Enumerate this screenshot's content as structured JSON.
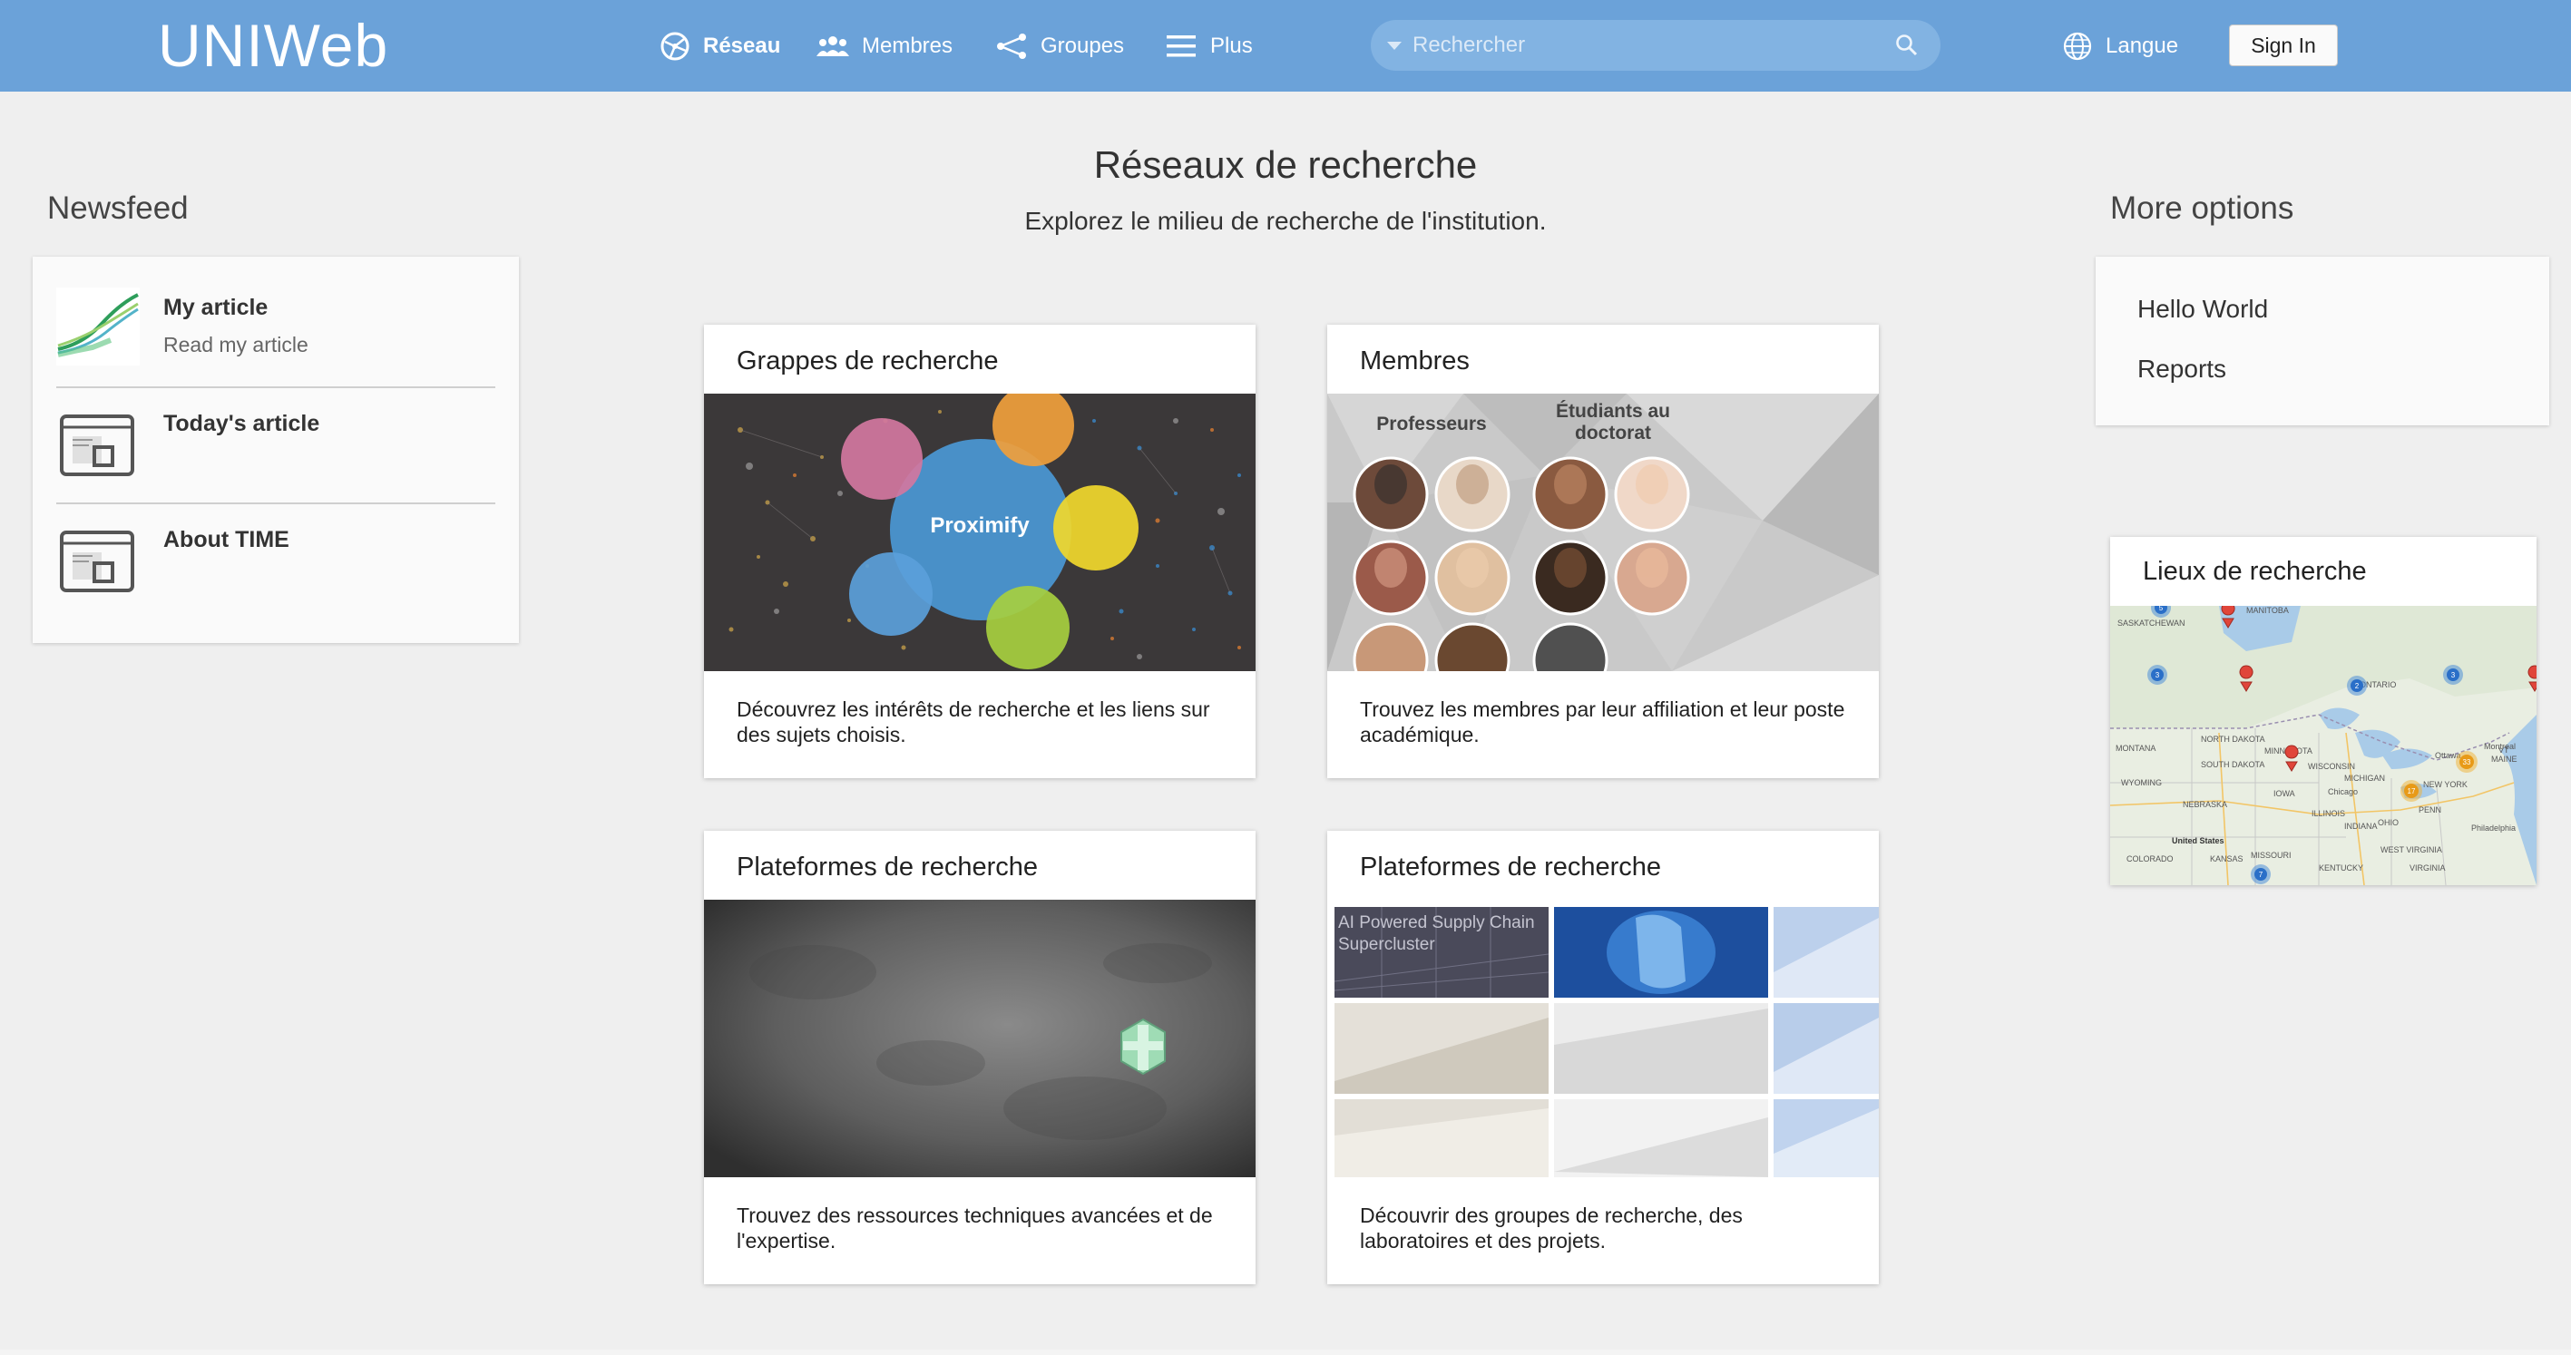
{
  "header": {
    "logo": "UNIWeb",
    "nav": [
      {
        "label": "Réseau",
        "icon": "globe-network-icon",
        "active": true
      },
      {
        "label": "Membres",
        "icon": "people-icon",
        "active": false
      },
      {
        "label": "Groupes",
        "icon": "share-nodes-icon",
        "active": false
      },
      {
        "label": "Plus",
        "icon": "hamburger-icon",
        "active": false
      }
    ],
    "search": {
      "placeholder": "Rechercher"
    },
    "language_label": "Langue",
    "signin_label": "Sign In",
    "accent_color": "#6ba2d9"
  },
  "newsfeed": {
    "title": "Newsfeed",
    "items": [
      {
        "title": "My article",
        "subtitle": "Read my article",
        "icon": "chart-thumbnail"
      },
      {
        "title": "Today's article",
        "subtitle": "",
        "icon": "newspaper-icon"
      },
      {
        "title": "About TIME",
        "subtitle": "",
        "icon": "newspaper-icon"
      }
    ]
  },
  "main": {
    "title": "Réseaux de recherche",
    "subtitle": "Explorez le milieu de recherche de l'institution.",
    "cards": [
      {
        "title": "Grappes de recherche",
        "description": "Découvrez les intérêts de recherche et les liens sur des sujets choisis.",
        "image_label": "Proximify"
      },
      {
        "title": "Membres",
        "description": "Trouvez les membres par leur affiliation et leur poste académique.",
        "image_labels": [
          "Professeurs",
          "Étudiants au doctorat"
        ]
      },
      {
        "title": "Plateformes de recherche",
        "description": "Trouvez des ressources techniques avancées et de l'expertise."
      },
      {
        "title": "Plateformes de recherche",
        "description": "Découvrir des groupes de recherche, des laboratoires et des projets.",
        "image_label": "AI Powered Supply Chain Supercluster"
      }
    ]
  },
  "more_options": {
    "title": "More options",
    "links": [
      "Hello World",
      "Reports"
    ]
  },
  "map": {
    "title": "Lieux de recherche",
    "labels": [
      "SASKATCHEWAN",
      "MANITOBA",
      "ONTARIO",
      "NORTH DAKOTA",
      "MONTANA",
      "SOUTH DAKOTA",
      "MINNESOTA",
      "WISCONSIN",
      "MICHIGAN",
      "WYOMING",
      "NEBRASKA",
      "IOWA",
      "ILLINOIS",
      "INDIANA",
      "OHIO",
      "PENN",
      "NEW YORK",
      "MAINE",
      "VT",
      "Ottawa",
      "Montreal",
      "Chicago",
      "Philadelphia",
      "United States",
      "COLORADO",
      "KANSAS",
      "MISSOURI",
      "KENTUCKY",
      "VIRGINIA",
      "WEST VIRGINIA"
    ],
    "cluster_counts": [
      "5",
      "3",
      "2",
      "3",
      "17",
      "33",
      "7"
    ]
  }
}
